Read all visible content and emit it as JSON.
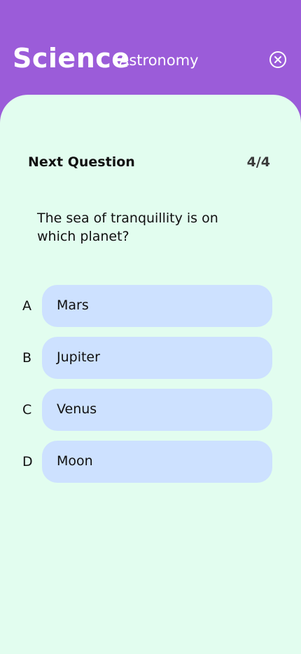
{
  "header": {
    "title": "Science",
    "subtitle": "Astronomy",
    "close_icon": "close-circle-icon"
  },
  "quiz": {
    "next_label": "Next Question",
    "counter": "4/4",
    "question": "The sea of tranquillity is on which planet?",
    "options": [
      {
        "letter": "A",
        "text": "Mars"
      },
      {
        "letter": "B",
        "text": "Jupiter"
      },
      {
        "letter": "C",
        "text": "Venus"
      },
      {
        "letter": "D",
        "text": "Moon"
      }
    ]
  },
  "colors": {
    "header_bg": "#9b5cd9",
    "panel_bg": "#e2fdef",
    "option_bg": "#cde1ff"
  }
}
